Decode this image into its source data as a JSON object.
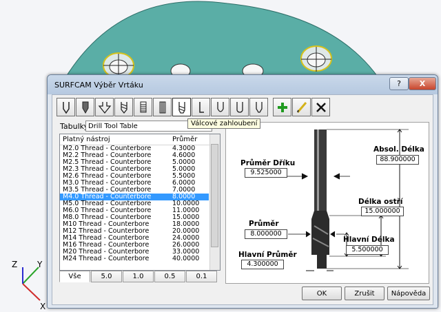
{
  "dialog": {
    "title": "SURFCAM Výběr Vrtáku",
    "help_label": "?",
    "close_label": "X"
  },
  "toolbar": {
    "tools": [
      "drill-point",
      "spot-drill",
      "countersink",
      "twist-drill",
      "tap",
      "reamer",
      "counterbore",
      "boring-bar",
      "ball-end",
      "bull-nose",
      "chamfer-mill"
    ],
    "actions": [
      "add-icon",
      "edit-icon",
      "delete-icon"
    ]
  },
  "tooltip": "Válcové zahloubení",
  "tables": {
    "label": "Tabulky:",
    "selected": "Drill Tool Table"
  },
  "list": {
    "headers": [
      "Platný nástroj",
      "Průměr"
    ],
    "selected_index": 7,
    "rows": [
      {
        "name": "M2.0 Thread  -  Counterbore",
        "dia": "4.3000"
      },
      {
        "name": "M2.2 Thread  -  Counterbore",
        "dia": "4.6000"
      },
      {
        "name": "M2.5 Thread  -  Counterbore",
        "dia": "5.0000"
      },
      {
        "name": "M2.3 Thread  -  Counterbore",
        "dia": "5.0000"
      },
      {
        "name": "M2.6 Thread  -  Counterbore",
        "dia": "5.5000"
      },
      {
        "name": "M3.0 Thread  -  Counterbore",
        "dia": "6.0000"
      },
      {
        "name": "M3.5 Thread  -  Counterbore",
        "dia": "7.0000"
      },
      {
        "name": "M4.0 Thread  -  Counterbore",
        "dia": "8.0000"
      },
      {
        "name": "M5.0 Thread  -  Counterbore",
        "dia": "10.0000"
      },
      {
        "name": "M6.0 Thread  -  Counterbore",
        "dia": "11.0000"
      },
      {
        "name": "M8.0 Thread  -  Counterbore",
        "dia": "15.0000"
      },
      {
        "name": "M10  Thread  -  Counterbore",
        "dia": "18.0000"
      },
      {
        "name": "M12  Thread  -  Counterbore",
        "dia": "20.0000"
      },
      {
        "name": "M14  Thread  -  Counterbore",
        "dia": "24.0000"
      },
      {
        "name": "M16  Thread  -  Counterbore",
        "dia": "26.0000"
      },
      {
        "name": "M20  Thread  -  Counterbore",
        "dia": "33.0000"
      },
      {
        "name": "M24  Thread  -  Counterbore",
        "dia": "40.0000"
      }
    ]
  },
  "filters": [
    "Vše",
    "5.0",
    "1.0",
    "0.5",
    "0.1"
  ],
  "diagram": {
    "shank_dia_label": "Průměr Dříku",
    "shank_dia_value": "9.525000",
    "abs_length_label": "Absol. Délka",
    "abs_length_value": "88.900000",
    "flute_length_label": "Délka ostří",
    "flute_length_value": "15.000000",
    "diameter_label": "Průměr",
    "diameter_value": "8.000000",
    "main_length_label": "Hlavní Délka",
    "main_length_value": "5.500000",
    "main_dia_label": "Hlavní Průměr",
    "main_dia_value": "4.300000"
  },
  "buttons": {
    "ok": "OK",
    "cancel": "Zrušit",
    "help": "Nápověda"
  },
  "axes": {
    "x": "X",
    "y": "Y",
    "z": "Z"
  },
  "colors": {
    "plate": "#5aaea6",
    "selection": "#3399ff",
    "add": "#1f9a1f"
  }
}
